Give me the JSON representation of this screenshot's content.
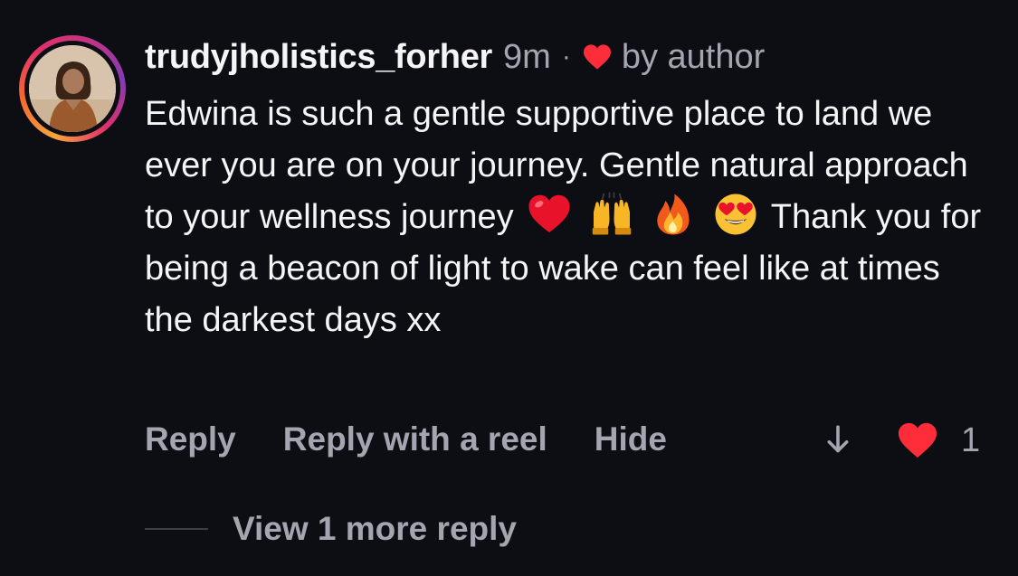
{
  "comment": {
    "username": "trudyjholistics_forher",
    "timestamp": "9m",
    "separator": "·",
    "liked_by_author_label": "by author",
    "text_part1": "Edwina is such a gentle supportive place to land we ever you are on your journey. Gentle natural approach to your wellness journey",
    "emojis": [
      "red-heart",
      "raising-hands",
      "fire",
      "heart-eyes"
    ],
    "text_part2": "Thank you for being a beacon of light to wake can feel like at times the darkest days xx"
  },
  "actions": {
    "reply": "Reply",
    "reply_with_reel": "Reply with a reel",
    "hide": "Hide",
    "like_count": "1"
  },
  "replies": {
    "view_more": "View 1 more reply"
  },
  "colors": {
    "background": "#0c0e14",
    "primary_text": "#f5f5f7",
    "secondary_text": "#a3a6b0",
    "like_red": "#ff2d3a"
  }
}
